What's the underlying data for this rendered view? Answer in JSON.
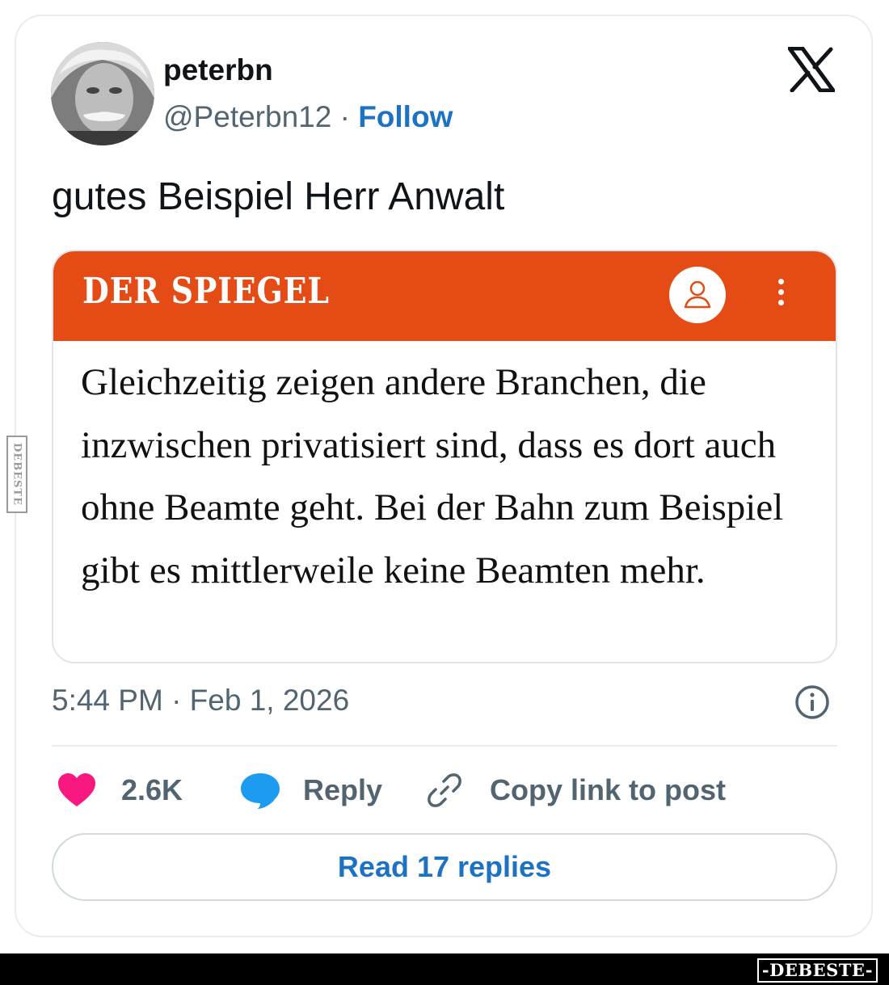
{
  "author": {
    "display_name": "peterbn",
    "handle": "@Peterbn12",
    "separator": "·",
    "follow_label": "Follow"
  },
  "tweet": {
    "text": "gutes Beispiel Herr Anwalt",
    "timestamp": "5:44 PM · Feb 1, 2026"
  },
  "embed": {
    "publication": "DER SPIEGEL",
    "brand_color": "#e54b15",
    "quote": "Gleichzeitig zeigen andere Branchen, die inzwischen privatisiert sind, dass es dort auch ohne Beamte geht. Bei der Bahn zum Beispiel gibt es mittlerweile keine Beamten mehr."
  },
  "actions": {
    "likes": "2.6K",
    "reply_label": "Reply",
    "copy_link_label": "Copy link to post",
    "read_replies_label": "Read 17 replies"
  },
  "colors": {
    "accent": "#1d72c4",
    "like": "#f91880",
    "reply": "#1d9bf0",
    "muted_text": "#536471"
  },
  "icons": {
    "brand": "x-logo-icon",
    "account": "user-icon",
    "menu": "kebab-menu-icon",
    "info": "info-icon",
    "like": "heart-icon",
    "reply": "speech-bubble-icon",
    "copy": "link-icon"
  },
  "watermark": {
    "side": "DEBESTE",
    "footer": "-DEBESTE-"
  }
}
